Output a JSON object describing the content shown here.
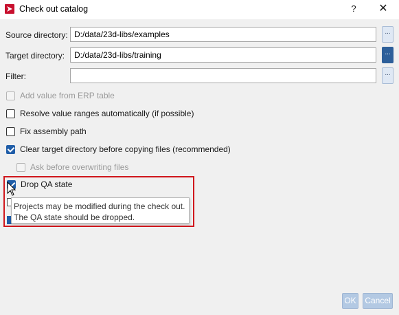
{
  "window": {
    "title": "Check out catalog",
    "help_label": "?",
    "close_label": "✕"
  },
  "fields": {
    "source": {
      "label": "Source directory:",
      "value": "D:/data/23d-libs/examples"
    },
    "target": {
      "label": "Target directory:",
      "value": "D:/data/23d-libs/training"
    },
    "filter": {
      "label": "Filter:",
      "value": ""
    },
    "browse_label": "..."
  },
  "options": {
    "erp": {
      "label": "Add value from ERP table",
      "checked": false,
      "enabled": false
    },
    "resolve": {
      "label": "Resolve value ranges automatically (if possible)",
      "checked": false,
      "enabled": true
    },
    "fix_path": {
      "label": "Fix assembly path",
      "checked": false,
      "enabled": true
    },
    "clear_target": {
      "label": "Clear target directory before copying files (recommended)",
      "checked": true,
      "enabled": true
    },
    "ask_overwrite": {
      "label": "Ask before overwriting files",
      "checked": false,
      "enabled": false
    },
    "drop_qa": {
      "label": "Drop QA state",
      "checked": true,
      "enabled": true
    }
  },
  "tooltip": {
    "line1": "Projects may be modified during the check out.",
    "line2": "The QA state should be dropped."
  },
  "footer": {
    "ok_label": "OK",
    "cancel_label": "Cancel"
  },
  "colors": {
    "accent": "#1f5da8",
    "highlight": "#d0161c",
    "disabled_button": "#b3c9e3"
  }
}
